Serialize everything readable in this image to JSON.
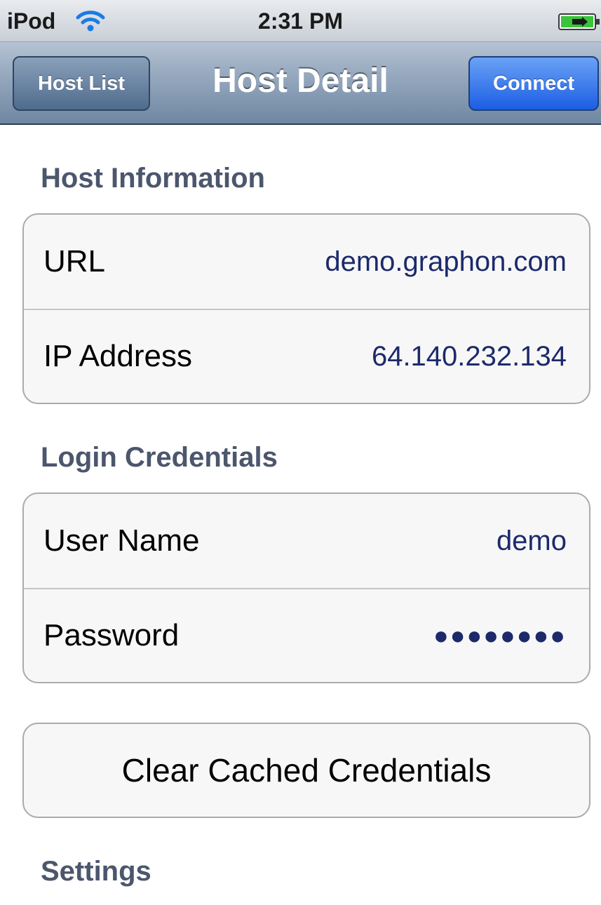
{
  "status_bar": {
    "carrier": "iPod",
    "time": "2:31 PM",
    "icons": [
      "wifi-icon",
      "battery-charging-icon"
    ]
  },
  "nav_bar": {
    "back_label": "Host List",
    "title": "Host Detail",
    "connect_label": "Connect"
  },
  "host_info": {
    "header": "Host Information",
    "rows": [
      {
        "label": "URL",
        "value": "demo.graphon.com"
      },
      {
        "label": "IP Address",
        "value": "64.140.232.134"
      }
    ]
  },
  "login": {
    "header": "Login Credentials",
    "rows": [
      {
        "label": "User Name",
        "value": "demo"
      },
      {
        "label": "Password",
        "value": "●●●●●●●●"
      }
    ]
  },
  "clear_button_label": "Clear Cached Credentials",
  "settings": {
    "header": "Settings"
  },
  "colors": {
    "value_text": "#1c2a6b",
    "section_header": "#4c566c",
    "connect_button": "#1c5ee3"
  }
}
